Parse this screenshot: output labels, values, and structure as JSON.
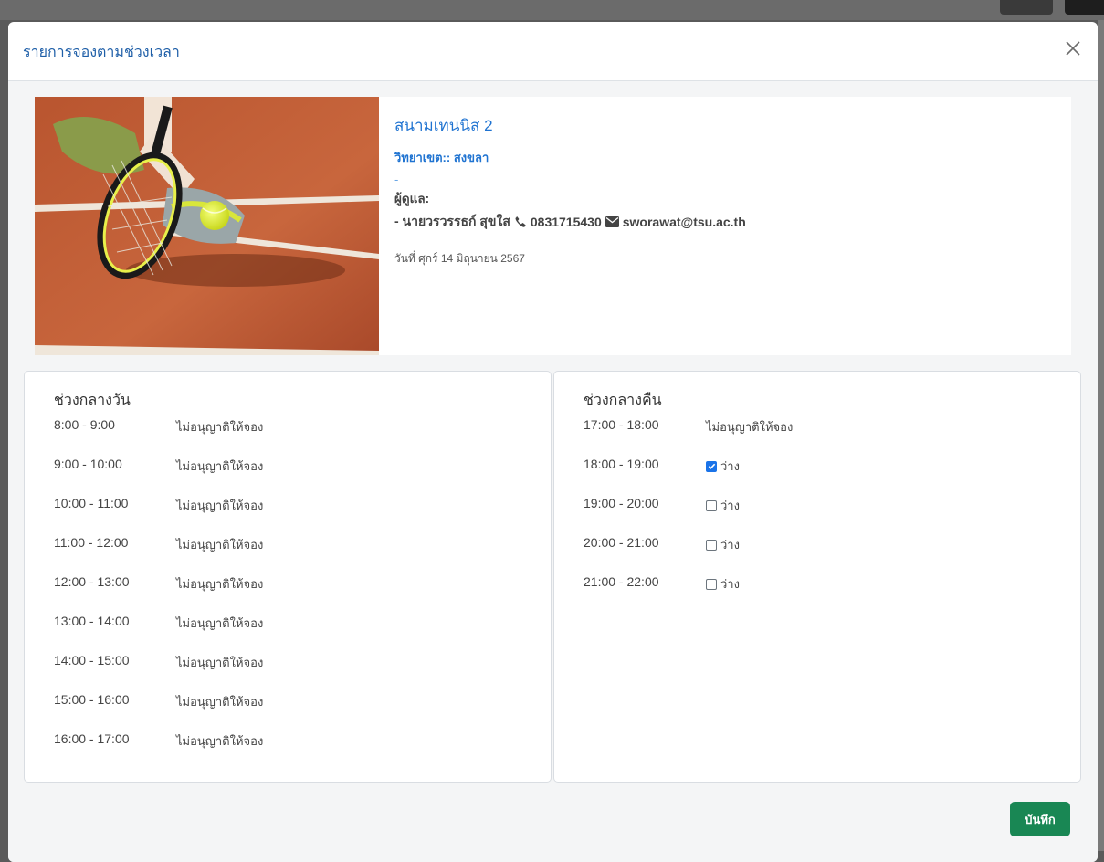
{
  "modal": {
    "title": "รายการจองตามช่วงเวลา",
    "save_label": "บันทึก"
  },
  "court": {
    "name": "สนามเทนนิส 2",
    "campus": "วิทยาเขต:: สงขลา",
    "dash": "-",
    "caretaker_label": "ผู้ดูแล:",
    "caretaker_name": "- นายวรวรรธก์ สุขใส",
    "phone": "0831715430",
    "email": "sworawat@tsu.ac.th",
    "date": "วันที่ ศุกร์ 14 มิถุนายน 2567"
  },
  "day_panel": {
    "title": "ช่วงกลางวัน",
    "slots": [
      {
        "time": "8:00 - 9:00",
        "status": "ไม่อนุญาติให้จอง"
      },
      {
        "time": "9:00 - 10:00",
        "status": "ไม่อนุญาติให้จอง"
      },
      {
        "time": "10:00 - 11:00",
        "status": "ไม่อนุญาติให้จอง"
      },
      {
        "time": "11:00 - 12:00",
        "status": "ไม่อนุญาติให้จอง"
      },
      {
        "time": "12:00 - 13:00",
        "status": "ไม่อนุญาติให้จอง"
      },
      {
        "time": "13:00 - 14:00",
        "status": "ไม่อนุญาติให้จอง"
      },
      {
        "time": "14:00 - 15:00",
        "status": "ไม่อนุญาติให้จอง"
      },
      {
        "time": "15:00 - 16:00",
        "status": "ไม่อนุญาติให้จอง"
      },
      {
        "time": "16:00 - 17:00",
        "status": "ไม่อนุญาติให้จอง"
      }
    ]
  },
  "night_panel": {
    "title": "ช่วงกลางคืน",
    "slots": [
      {
        "time": "17:00 - 18:00",
        "status": "ไม่อนุญาติให้จอง",
        "bookable": false
      },
      {
        "time": "18:00 - 19:00",
        "status": "ว่าง",
        "bookable": true,
        "checked": true
      },
      {
        "time": "19:00 - 20:00",
        "status": "ว่าง",
        "bookable": true,
        "checked": false
      },
      {
        "time": "20:00 - 21:00",
        "status": "ว่าง",
        "bookable": true,
        "checked": false
      },
      {
        "time": "21:00 - 22:00",
        "status": "ว่าง",
        "bookable": true,
        "checked": false
      }
    ]
  },
  "colors": {
    "title_blue": "#1f5fa8",
    "link_blue": "#1f73d1",
    "save_green": "#198754",
    "checkbox_blue": "#1a73e8"
  },
  "icons": {
    "close": "close-icon",
    "phone": "phone-icon",
    "email": "envelope-icon",
    "photo": "tennis-court-photo"
  }
}
